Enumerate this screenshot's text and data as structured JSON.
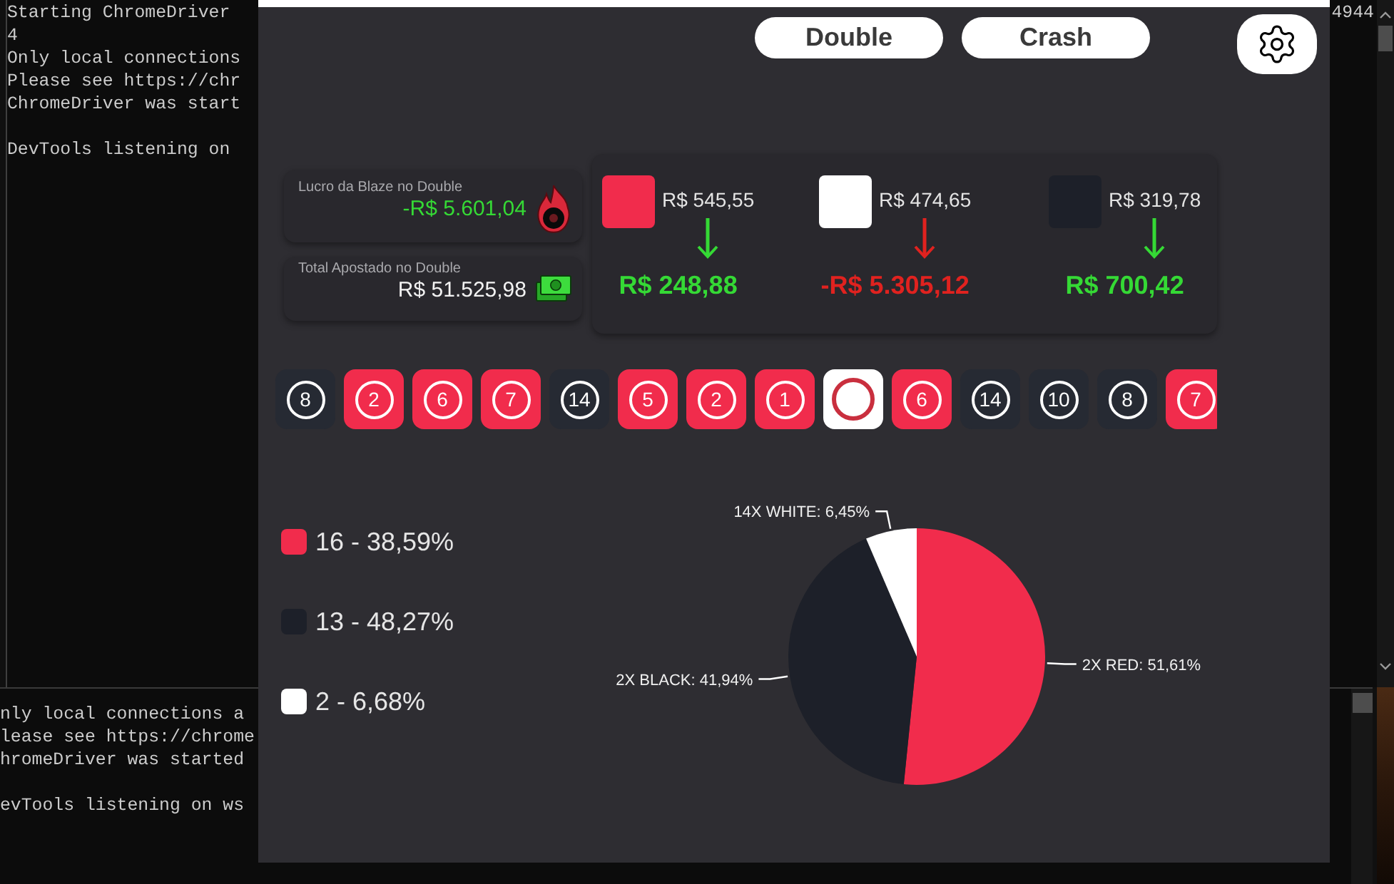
{
  "terminal_windows": [
    {
      "line_end": "4944",
      "paragraphs": [
        [
          "Starting ChromeDriver",
          "4",
          "Only local connections",
          "Please see https://chr",
          "ChromeDriver was start"
        ],
        [
          "DevTools listening on"
        ]
      ]
    },
    {
      "paragraphs": [
        [
          "nly local connections a",
          "lease see https://chrome",
          "hromeDriver was started"
        ],
        [
          "evTools listening on ws"
        ]
      ]
    }
  ],
  "app": {
    "mode_buttons": [
      "Double",
      "Crash"
    ],
    "summary_cards": [
      {
        "kind": "profit",
        "label": "Lucro da Blaze no Double",
        "value": "-R$ 5.601,04"
      },
      {
        "kind": "total",
        "label": "Total Apostado no Double",
        "value": "R$ 51.525,98"
      }
    ],
    "color_results": [
      {
        "color": "#f12c4c",
        "bet": "R$ 545,55",
        "positive": true,
        "result": "R$ 248,88"
      },
      {
        "color": "#ffffff",
        "bet": "R$ 474,65",
        "positive": false,
        "result": "-R$ 5.305,12"
      },
      {
        "color": "#1d2029",
        "bet": "R$ 319,78",
        "positive": true,
        "result": "R$ 700,42"
      }
    ],
    "history": [
      {
        "color": "#262a33",
        "number": "8"
      },
      {
        "color": "#f12c4c",
        "number": "2"
      },
      {
        "color": "#f12c4c",
        "number": "6"
      },
      {
        "color": "#f12c4c",
        "number": "7"
      },
      {
        "color": "#262a33",
        "number": "14"
      },
      {
        "color": "#f12c4c",
        "number": "5"
      },
      {
        "color": "#f12c4c",
        "number": "2"
      },
      {
        "color": "#f12c4c",
        "number": "1"
      },
      {
        "color": "#ffffff"
      },
      {
        "color": "#f12c4c",
        "number": "6"
      },
      {
        "color": "#262a33",
        "number": "14"
      },
      {
        "color": "#262a33",
        "number": "10"
      },
      {
        "color": "#262a33",
        "number": "8"
      },
      {
        "color": "#f12c4c",
        "number": "7"
      }
    ],
    "legend": [
      {
        "color": "#f12c4c",
        "text": "16 - 38,59%"
      },
      {
        "color": "#1d2029",
        "text": "13 - 48,27%"
      },
      {
        "color": "#ffffff",
        "text": "2 - 6,68%"
      }
    ],
    "chart_data": {
      "type": "pie",
      "categories": [
        "2X RED: 51,61%",
        "2X BLACK: 41,94%",
        "14X WHITE: 6,45%"
      ],
      "values": [
        51.61,
        41.94,
        6.45
      ]
    }
  }
}
